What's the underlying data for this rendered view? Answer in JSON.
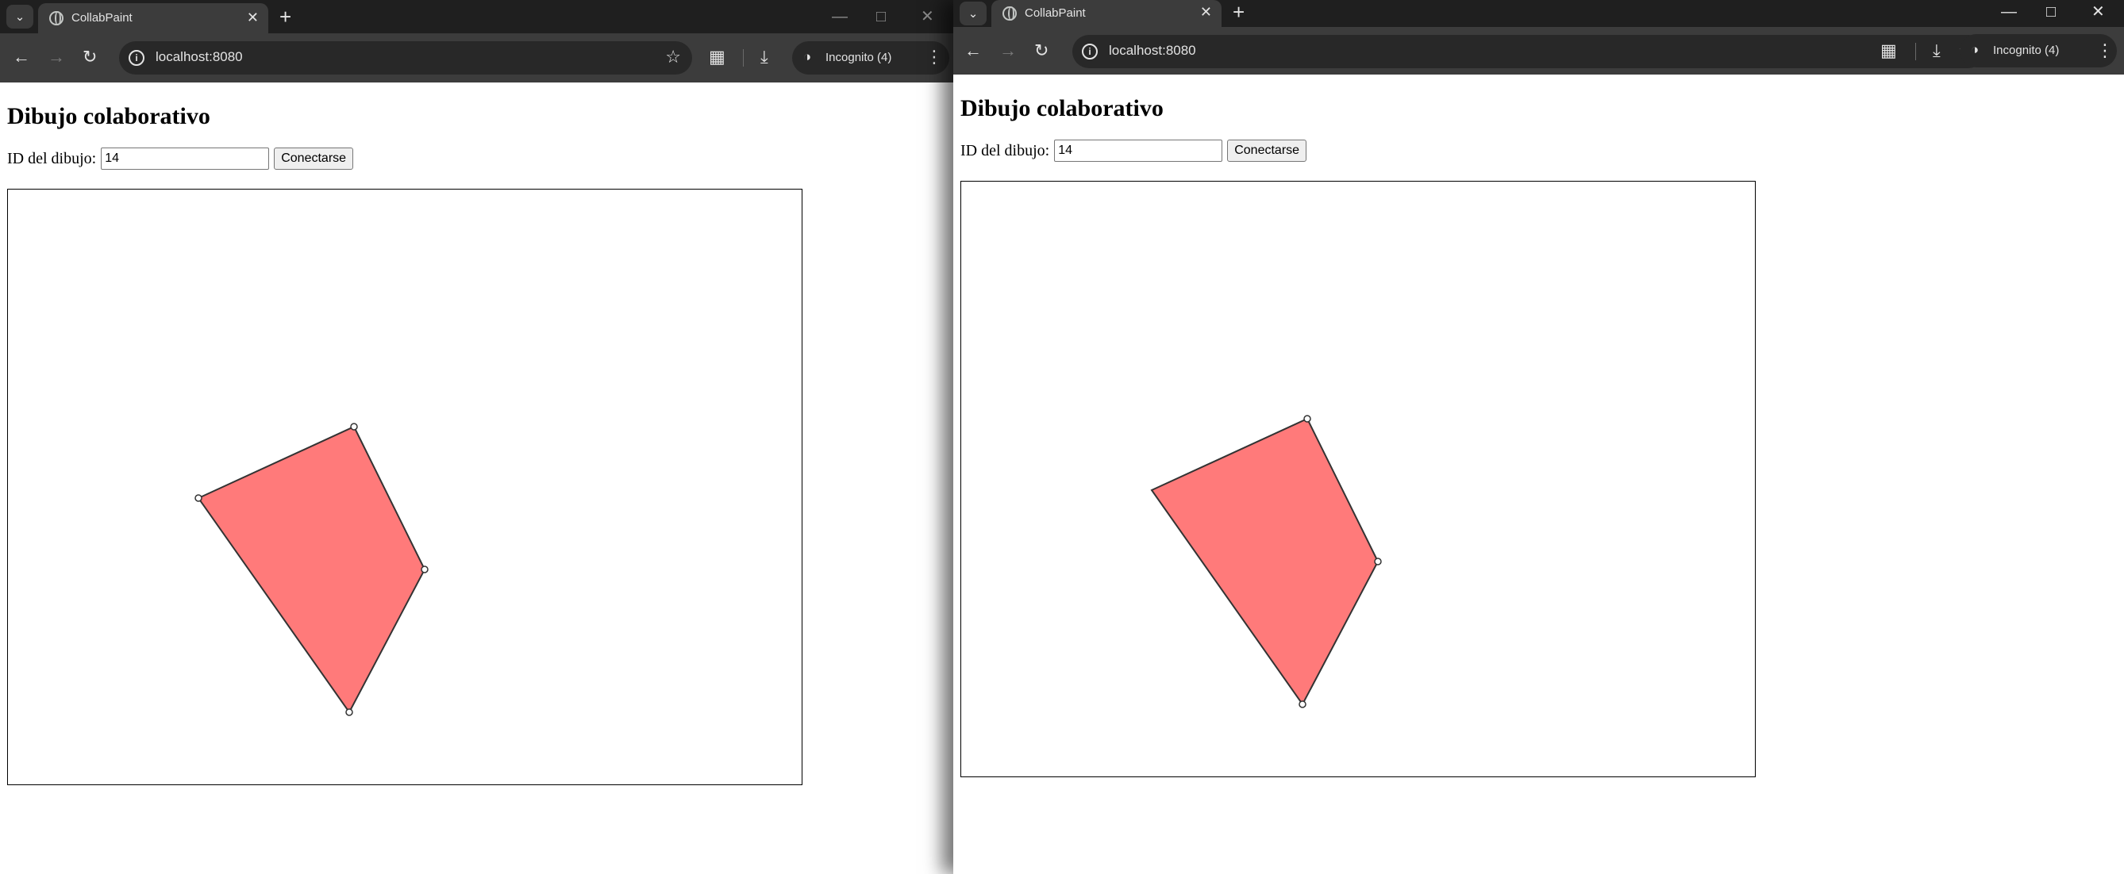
{
  "tab_title": "CollabPaint",
  "url": "localhost:8080",
  "incognito_label": "Incognito (4)",
  "page": {
    "title": "Dibujo colaborativo",
    "id_label": "ID del dibujo:",
    "id_value": "14",
    "connect_label": "Conectarse"
  },
  "colors": {
    "polygon_fill": "#ff7a7a",
    "polygon_stroke": "#333333"
  },
  "icons": {
    "tab_search": "chevron-down-icon",
    "favicon": "globe-icon",
    "close": "close-icon",
    "new_tab": "plus-icon",
    "back": "arrow-left-icon",
    "forward": "arrow-right-icon",
    "reload": "reload-icon",
    "info": "info-icon",
    "bookmark": "star-icon",
    "extensions": "puzzle-icon",
    "downloads": "download-icon",
    "incognito": "incognito-icon",
    "menu": "kebab-menu-icon"
  }
}
